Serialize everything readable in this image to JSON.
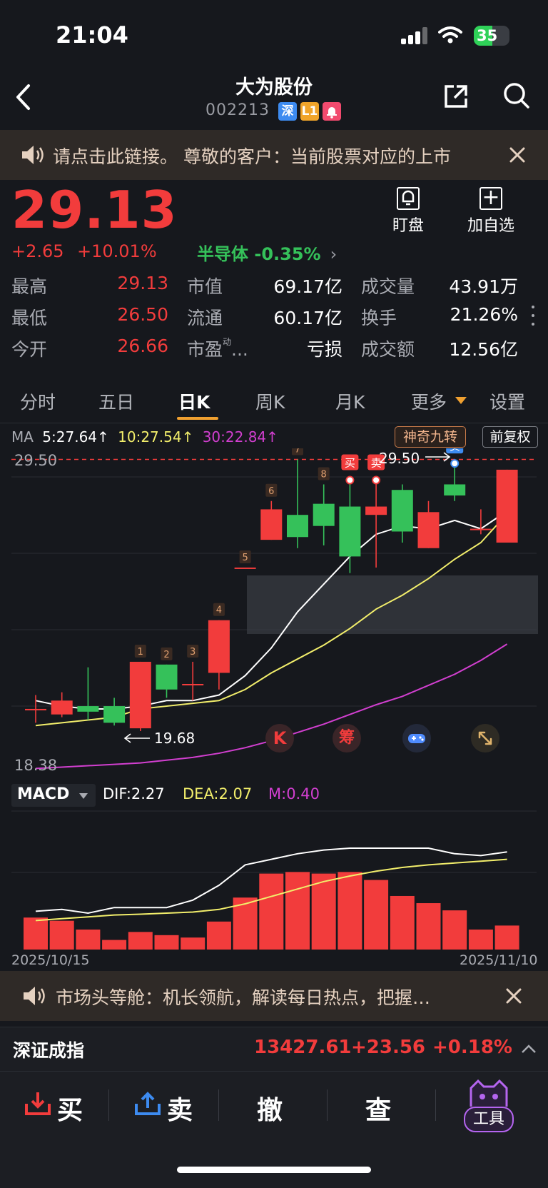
{
  "status_bar": {
    "time": "21:04",
    "battery": "35"
  },
  "nav": {
    "title": "大为股份",
    "code": "002213",
    "tags": [
      "深",
      "L1"
    ]
  },
  "notice_top": {
    "text": "请点击此链接。 尊敬的客户：当前股票对应的上市"
  },
  "quote": {
    "price": "29.13",
    "change": "+2.65",
    "change_pct": "+10.01%",
    "sector": "半导体 -0.35%",
    "watch_label": "盯盘",
    "add_label": "加自选",
    "stats": [
      {
        "label": "最高",
        "value": "29.13"
      },
      {
        "label": "最低",
        "value": "26.50"
      },
      {
        "label": "今开",
        "value": "26.66"
      },
      {
        "label": "市值",
        "value": "69.17亿"
      },
      {
        "label": "流通",
        "value": "60.17亿"
      },
      {
        "label": "市盈",
        "value": "亏损"
      },
      {
        "label": "成交量",
        "value": "43.91万"
      },
      {
        "label": "换手",
        "value": "21.26%"
      },
      {
        "label": "成交额",
        "value": "12.56亿"
      }
    ],
    "pe_sup": "动"
  },
  "tabs": [
    "分时",
    "五日",
    "日K",
    "周K",
    "月K",
    "更多",
    "设置"
  ],
  "ma_legend": {
    "label": "MA",
    "ma5": "5:27.64↑",
    "ma10": "10:27.54↑",
    "ma30": "30:22.84↑"
  },
  "buttons": {
    "magic": "神奇九转",
    "adjust": "前复权"
  },
  "kline": {
    "price_high_label": "29.50",
    "price_low_label": "18.38",
    "min_marker": "19.68",
    "max_marker": "29.50",
    "seq_numbers": [
      "1",
      "2",
      "3",
      "4",
      "5",
      "6",
      "7",
      "8"
    ],
    "buy_label": "买",
    "sell_label": "卖",
    "icons": {
      "k": "K",
      "chip": "筹"
    },
    "candles": [
      {
        "o": 20.5,
        "c": 20.5,
        "h": 21.0,
        "l": 20.0
      },
      {
        "o": 20.3,
        "c": 20.8,
        "h": 21.1,
        "l": 20.2
      },
      {
        "o": 20.6,
        "c": 20.4,
        "h": 22.0,
        "l": 20.1
      },
      {
        "o": 20.6,
        "c": 20.0,
        "h": 20.9,
        "l": 19.9
      },
      {
        "o": 19.8,
        "c": 22.2,
        "h": 22.2,
        "l": 19.7
      },
      {
        "o": 22.1,
        "c": 21.2,
        "h": 22.1,
        "l": 20.9
      },
      {
        "o": 21.4,
        "c": 21.4,
        "h": 22.2,
        "l": 20.8
      },
      {
        "o": 21.8,
        "c": 23.7,
        "h": 23.7,
        "l": 21.2
      },
      {
        "o": 25.6,
        "c": 25.6,
        "h": 25.6,
        "l": 25.6
      },
      {
        "o": 26.6,
        "c": 27.7,
        "h": 28.0,
        "l": 26.6
      },
      {
        "o": 27.5,
        "c": 26.7,
        "h": 29.5,
        "l": 26.3
      },
      {
        "o": 27.9,
        "c": 27.1,
        "h": 28.6,
        "l": 26.4
      },
      {
        "o": 27.8,
        "c": 26.0,
        "h": 28.6,
        "l": 25.4
      },
      {
        "o": 27.5,
        "c": 27.8,
        "h": 28.6,
        "l": 25.6
      },
      {
        "o": 28.4,
        "c": 26.9,
        "h": 28.6,
        "l": 26.5
      },
      {
        "o": 26.3,
        "c": 27.6,
        "h": 28.0,
        "l": 26.3
      },
      {
        "o": 28.6,
        "c": 28.2,
        "h": 29.2,
        "l": 28.0
      },
      {
        "o": 27.0,
        "c": 27.0,
        "h": 27.7,
        "l": 26.8
      },
      {
        "o": 26.5,
        "c": 29.13,
        "h": 29.13,
        "l": 26.5
      }
    ],
    "ma5": [
      20.8,
      20.6,
      20.5,
      20.5,
      20.6,
      20.8,
      20.8,
      21.0,
      21.7,
      22.7,
      24.0,
      25.0,
      26.0,
      26.8,
      27.1,
      27.0,
      27.3,
      27.0,
      27.64
    ],
    "ma10": [
      19.9,
      20.0,
      20.1,
      20.2,
      20.5,
      20.6,
      20.7,
      20.8,
      21.2,
      21.8,
      22.3,
      22.8,
      23.4,
      24.1,
      24.6,
      25.2,
      25.9,
      26.5,
      27.54
    ],
    "ma30": [
      18.35,
      18.4,
      18.45,
      18.5,
      18.55,
      18.65,
      18.75,
      18.9,
      19.1,
      19.35,
      19.65,
      19.95,
      20.3,
      20.65,
      20.95,
      21.35,
      21.75,
      22.25,
      22.84
    ]
  },
  "macd": {
    "label": "MACD",
    "dif": "DIF:2.27",
    "dea": "DEA:2.07",
    "m": "M:0.40",
    "dif_series": [
      0.8,
      0.85,
      0.75,
      0.9,
      0.9,
      0.9,
      1.1,
      1.5,
      2.05,
      2.2,
      2.35,
      2.45,
      2.5,
      2.5,
      2.5,
      2.5,
      2.35,
      2.3,
      2.4
    ],
    "dea_series": [
      0.55,
      0.6,
      0.65,
      0.7,
      0.72,
      0.75,
      0.78,
      0.85,
      1.0,
      1.2,
      1.4,
      1.6,
      1.75,
      1.88,
      1.98,
      2.05,
      2.1,
      2.15,
      2.2
    ],
    "hist": [
      0.4,
      0.36,
      0.25,
      0.12,
      0.22,
      0.18,
      0.15,
      0.35,
      0.65,
      0.95,
      0.97,
      0.95,
      0.97,
      0.87,
      0.67,
      0.58,
      0.49,
      0.25,
      0.3
    ],
    "date_start": "2025/10/15",
    "date_end": "2025/11/10"
  },
  "notice_bottom": {
    "text": "市场头等舱：机长领航，解读每日热点，把握…"
  },
  "index": {
    "name": "深证成指",
    "value": "13427.61",
    "change": "+23.56",
    "pct": "+0.18%"
  },
  "actions": {
    "buy": "买",
    "sell": "卖",
    "cancel": "撤",
    "query": "查",
    "tools": "工具"
  },
  "colors": {
    "up": "#f23c3c",
    "down": "#35c15a",
    "bg": "#16181d",
    "ma5": "#ffffff",
    "ma10": "#f2ee6b",
    "ma30": "#d23fd0"
  }
}
